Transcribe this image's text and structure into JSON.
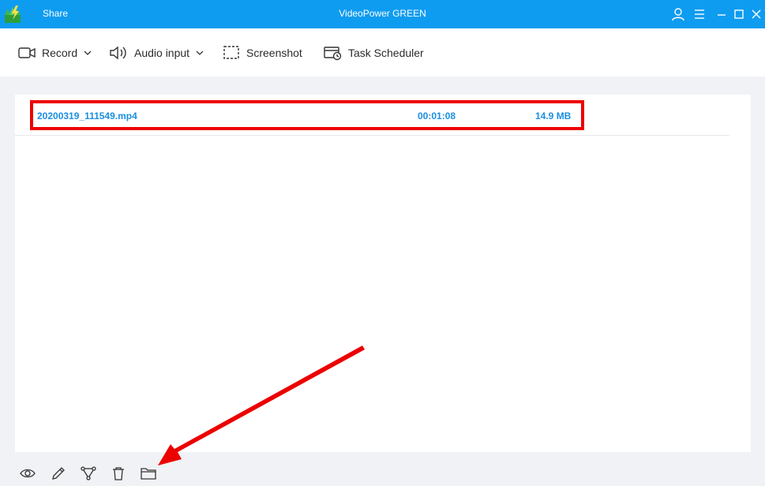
{
  "titlebar": {
    "share_label": "Share",
    "app_title": "VideoPower GREEN"
  },
  "toolbar": {
    "record_label": "Record",
    "audio_input_label": "Audio input",
    "screenshot_label": "Screenshot",
    "task_scheduler_label": "Task Scheduler"
  },
  "files": [
    {
      "name": "20200319_111549.mp4",
      "duration": "00:01:08",
      "size": "14.9 MB"
    }
  ],
  "icons": {
    "titlebar": [
      "app-logo-icon",
      "user-icon",
      "menu-icon",
      "minimize-icon",
      "maximize-icon",
      "close-icon"
    ],
    "toolbar": [
      "video-camera-icon",
      "chevron-down-icon",
      "speaker-icon",
      "screenshot-icon",
      "calendar-clock-icon"
    ],
    "bottom": [
      "eye-icon",
      "pencil-icon",
      "share-nodes-icon",
      "trash-icon",
      "folder-icon"
    ]
  },
  "colors": {
    "titlebar_bg": "#0e9cf0",
    "file_text": "#1a8fe0",
    "annotation_red": "#ec0000"
  }
}
